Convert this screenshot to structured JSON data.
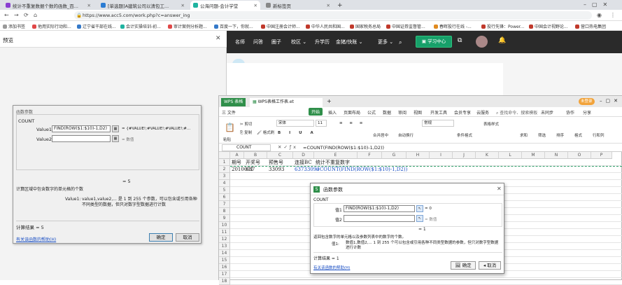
{
  "browser": {
    "tabs": [
      {
        "label": "统计不重复数据个数的函数_百...",
        "color": "#8a3fd1"
      },
      {
        "label": "[单选题]A建筑公司以清包工...",
        "color": "#2b7cd3"
      },
      {
        "label": "公海问题-会计学堂",
        "color": "#1fb3a0"
      },
      {
        "label": "新标签页",
        "color": "#888888"
      }
    ],
    "url": "https://www.acc5.com/work.php?c=answer_ing",
    "bookmarks": [
      "添加书签",
      "他用实际行动和...",
      "辽宁省干部在线...",
      "会计实操培训-初...",
      "审计案例分析题...",
      "百度一下，你就...",
      "中国注册会计师...",
      "中华人民共和国...",
      "国家税务总局",
      "中国证券监督管...",
      "春晖投行在线 -...",
      "投行先锋：Power...",
      "中国会计视野论...",
      "营口热电集团"
    ]
  },
  "left_dialog": {
    "window_title": "预览",
    "title": "函数参数",
    "func": "COUNT",
    "value1_label": "Value1",
    "value1": "FIND(ROW($1:$10)-1,D2)",
    "value1_result": "= {#VALUE!;#VALUE!;#VALUE!;#...",
    "value2_label": "Value2",
    "value2_result": "= 数值",
    "equals": "= 5",
    "desc": "计算区域中包含数字的单元格的个数",
    "arg_name": "Value1:",
    "arg_desc": "value1,value2,... 是 1 到 255 个参数，可以包含或引用各种不同类型的数据，但只对数字型数据进行计数",
    "result": "计算结果 =  5",
    "help_link": "有关该函数的帮助(H)",
    "ok": "确定",
    "cancel": "取消"
  },
  "site": {
    "nav": [
      "名师",
      "问答",
      "圈子",
      "校区 ⌄",
      "升学历",
      "金猪/快账 ⌄",
      "更多 ⌄"
    ],
    "study_center": "学习中心"
  },
  "wps": {
    "app_tab": "WPS 表格",
    "doc_tab": "WPS表格工作表.et",
    "login": "未登录",
    "menu": [
      "三 文件",
      "开始",
      "插入",
      "页面布局",
      "公式",
      "数据",
      "审阅",
      "视图",
      "开发工具",
      "会员专享",
      "云服务",
      "查找命令、搜索模板",
      "未同步",
      "协作",
      "分享"
    ],
    "toolbar": [
      "剪切",
      "复制",
      "格式刷",
      "粘贴",
      "宋体",
      "11",
      "合并居中",
      "自动换行",
      "常规",
      "条件格式",
      "表格样式",
      "求和",
      "筛选",
      "排序",
      "格式",
      "行和列"
    ],
    "name_box": "COUNT",
    "formula": "=COUNT(FIND(ROW($1:$10)-1,D2))",
    "columns": [
      "A",
      "B",
      "C",
      "D",
      "E",
      "F",
      "G",
      "H",
      "I",
      "J",
      "K",
      "L",
      "M",
      "N",
      "O",
      "P"
    ],
    "rows": [
      "1",
      "2",
      "3",
      "4",
      "5",
      "6",
      "7",
      "8",
      "9",
      "10",
      "11",
      "12",
      "13",
      "14",
      "15",
      "16",
      "17",
      "18"
    ],
    "cells": {
      "A1": "期号",
      "B1": "开奖号",
      "C1": "预售号",
      "D1": "连接BC",
      "E1": "统计不重复数字",
      "A2": "2010001",
      "B2": "637",
      "C2": "33093",
      "D2": "63733093",
      "E2": "=COUNT(FIND(ROW($1:$10)-1,D2))"
    },
    "dialog": {
      "title": "函数参数",
      "func": "COUNT",
      "v1_label": "值1",
      "v1": "FIND(ROW($1:$10)-1,D2)",
      "v1_result": "= 0",
      "v2_label": "值2",
      "v2_result": "= 数值",
      "equals": "= 1",
      "desc": "返回包含数字的单元格以及参数列表中的数字的个数。",
      "arg_name": "值1:",
      "arg_desc": "数值1,数值2,... 1 到 255 个可以包含或引用各种不同类型数据的参数，但只对数字型数据进行计数",
      "result": "计算结果 =  1",
      "help_link": "有关该函数的帮助(H)",
      "ok": "确定",
      "cancel": "取消"
    }
  }
}
